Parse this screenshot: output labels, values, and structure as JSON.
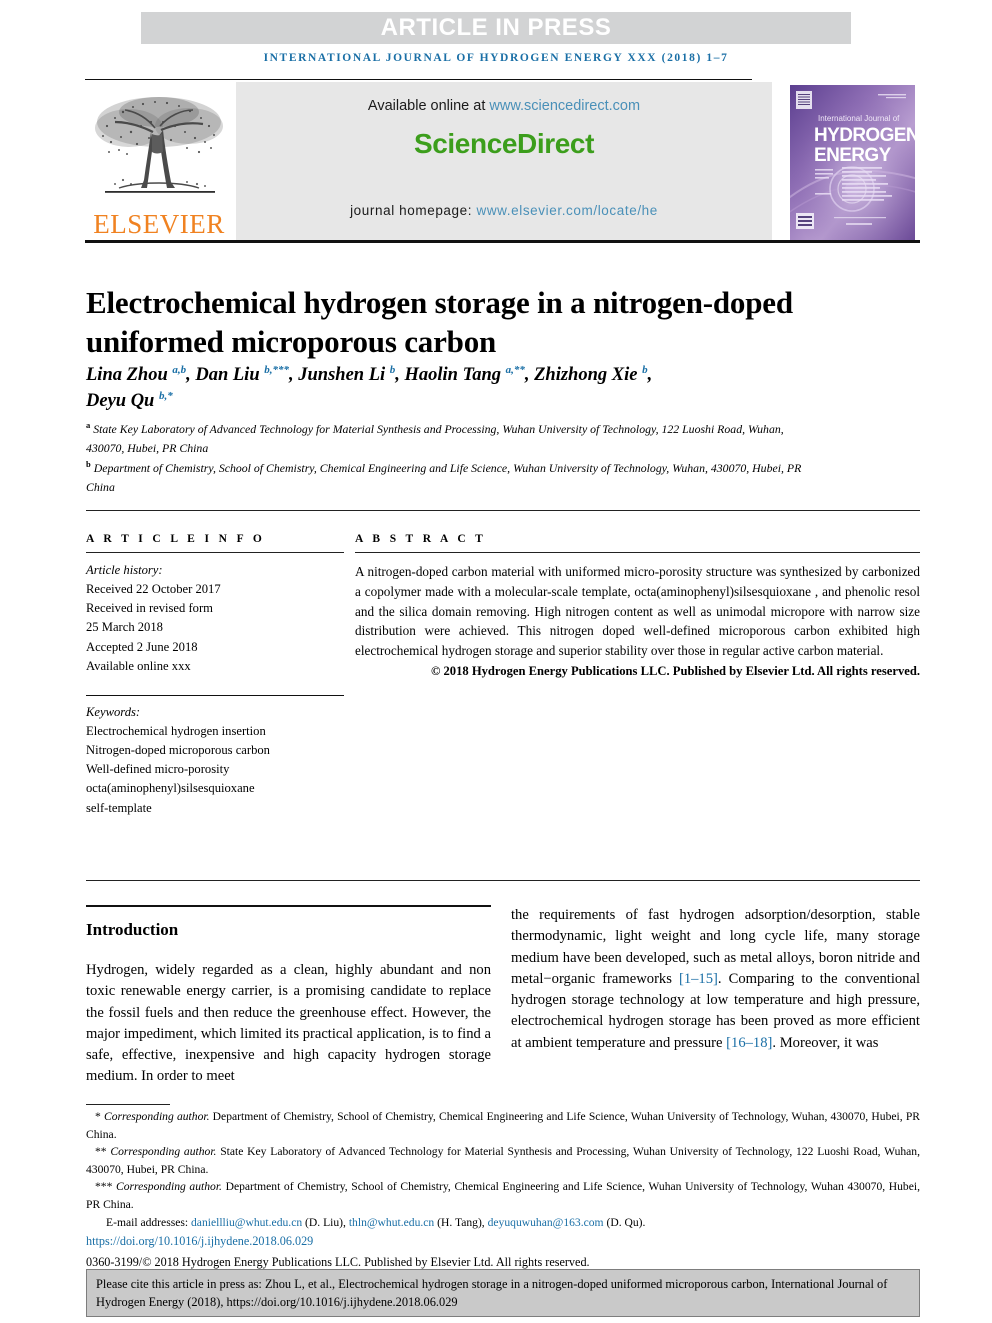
{
  "banner": {
    "article_in_press": "ARTICLE IN PRESS",
    "running_head": "INTERNATIONAL JOURNAL OF HYDROGEN ENERGY XXX (2018) 1–7"
  },
  "masthead": {
    "publisher_name": "ELSEVIER",
    "available_prefix": "Available online at ",
    "available_url": "www.sciencedirect.com",
    "sciencedirect_logo": "ScienceDirect",
    "homepage_prefix": "journal homepage: ",
    "homepage_url": "www.elsevier.com/locate/he",
    "cover": {
      "line1": "International Journal of",
      "line2": "HYDROGEN",
      "line3": "ENERGY"
    },
    "colors": {
      "sciencedirect_green": "#3c9e1c",
      "elsevier_orange": "#f08221",
      "link_blue": "#4a90b8",
      "banner_grey": "#d2d3d4",
      "masthead_grey": "#e7e7e7"
    }
  },
  "article": {
    "title": "Electrochemical hydrogen storage in a nitrogen-doped uniformed microporous carbon",
    "authors": [
      {
        "name": "Lina Zhou",
        "marks": "a,b",
        "sep": ", "
      },
      {
        "name": "Dan Liu",
        "marks": "b,***",
        "sep": ", "
      },
      {
        "name": "Junshen Li",
        "marks": "b",
        "sep": ", "
      },
      {
        "name": "Haolin Tang",
        "marks": "a,**",
        "sep": ", "
      },
      {
        "name": "Zhizhong Xie",
        "marks": "b",
        "sep": ", "
      },
      {
        "name": "Deyu Qu",
        "marks": "b,*",
        "sep": ""
      }
    ],
    "affiliations": [
      {
        "mark": "a",
        "text": "State Key Laboratory of Advanced Technology for Material Synthesis and Processing, Wuhan University of Technology, 122 Luoshi Road, Wuhan, 430070, Hubei, PR China"
      },
      {
        "mark": "b",
        "text": "Department of Chemistry, School of Chemistry, Chemical Engineering and Life Science, Wuhan University of Technology, Wuhan, 430070, Hubei, PR China"
      }
    ]
  },
  "article_info": {
    "heading": "A R T I C L E   I N F O",
    "history_label": "Article history:",
    "history": [
      "Received 22 October 2017",
      "Received in revised form",
      "25 March 2018",
      "Accepted 2 June 2018",
      "Available online xxx"
    ],
    "keywords_label": "Keywords:",
    "keywords": [
      "Electrochemical hydrogen insertion",
      "Nitrogen-doped microporous carbon",
      "Well-defined micro-porosity",
      "octa(aminophenyl)silsesquioxane",
      "self-template"
    ]
  },
  "abstract": {
    "heading": "A B S T R A C T",
    "text": "A nitrogen-doped carbon material with uniformed micro-porosity structure was synthesized by carbonized a copolymer made with a molecular-scale template, octa(aminophenyl)silsesquioxane , and phenolic resol and the silica domain removing. High nitrogen content as well as unimodal micropore with narrow size distribution were achieved. This nitrogen doped well-defined microporous carbon exhibited high electrochemical hydrogen storage and superior stability over those in regular active carbon material.",
    "copyright": "© 2018 Hydrogen Energy Publications LLC. Published by Elsevier Ltd. All rights reserved."
  },
  "body": {
    "intro_heading": "Introduction",
    "left_paragraph": "Hydrogen, widely regarded as a clean, highly abundant and non toxic renewable energy carrier, is a promising candidate to replace the fossil fuels and then reduce the greenhouse effect. However, the major impediment, which limited its practical application, is to find a safe, effective, inexpensive and high capacity hydrogen storage medium. In order to meet",
    "right_paragraph_part1": "the requirements of fast hydrogen adsorption/desorption, stable thermodynamic, light weight and long cycle life, many storage medium have been developed, such as metal alloys, boron nitride and metal−organic frameworks ",
    "right_ref1": "[1–15]",
    "right_paragraph_part2": ". Comparing to the conventional hydrogen storage technology at low temperature and high pressure, electrochemical hydrogen storage has been proved as more efficient at ambient temperature and pressure ",
    "right_ref2": "[16–18]",
    "right_paragraph_part3": ". Moreover, it was"
  },
  "footnotes": {
    "items": [
      {
        "mark": "*",
        "italic": "Corresponding author.",
        "text": " Department of Chemistry, School of Chemistry, Chemical Engineering and Life Science, Wuhan University of Technology, Wuhan, 430070, Hubei, PR China."
      },
      {
        "mark": "**",
        "italic": "Corresponding author.",
        "text": " State Key Laboratory of Advanced Technology for Material Synthesis and Processing, Wuhan University of Technology, 122 Luoshi Road, Wuhan, 430070, Hubei, PR China."
      },
      {
        "mark": "***",
        "italic": "Corresponding author.",
        "text": " Department of Chemistry, School of Chemistry, Chemical Engineering and Life Science, Wuhan University of Technology, Wuhan 430070, Hubei, PR China."
      }
    ],
    "email_label": "E-mail addresses: ",
    "emails": [
      {
        "address": "daniellliu@whut.edu.cn",
        "owner": " (D. Liu), "
      },
      {
        "address": "thln@whut.edu.cn",
        "owner": " (H. Tang), "
      },
      {
        "address": "deyuquwuhan@163.com",
        "owner": " (D. Qu)."
      }
    ],
    "doi": "https://doi.org/10.1016/j.ijhydene.2018.06.029",
    "issn_line": "0360-3199/© 2018 Hydrogen Energy Publications LLC. Published by Elsevier Ltd. All rights reserved."
  },
  "citation_box": {
    "text": "Please cite this article in press as: Zhou L, et al., Electrochemical hydrogen storage in a nitrogen-doped uniformed microporous carbon, International Journal of Hydrogen Energy (2018), https://doi.org/10.1016/j.ijhydene.2018.06.029"
  }
}
